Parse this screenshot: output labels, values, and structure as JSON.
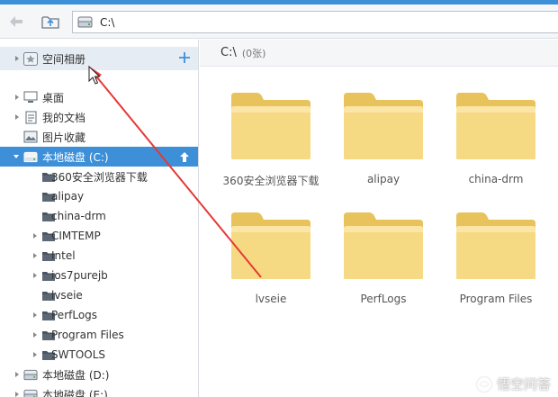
{
  "toolbar": {
    "back_icon": "back-arrow-icon",
    "up_icon": "up-folder-icon",
    "address": "C:\\",
    "address_icon": "drive-icon"
  },
  "sidebar": {
    "album": {
      "label": "空间相册",
      "icon": "album-star-icon",
      "add_icon": "plus-icon"
    },
    "items": [
      {
        "label": "桌面",
        "icon": "desktop-icon",
        "expandable": true
      },
      {
        "label": "我的文档",
        "icon": "documents-icon",
        "expandable": true
      },
      {
        "label": "图片收藏",
        "icon": "pictures-icon",
        "expandable": false
      },
      {
        "label": "本地磁盘 (C:)",
        "icon": "drive-icon",
        "expandable": true,
        "expanded": true,
        "selected": true
      },
      {
        "label": "360安全浏览器下载",
        "icon": "folder-icon",
        "expandable": false,
        "child": true
      },
      {
        "label": "alipay",
        "icon": "folder-icon",
        "expandable": false,
        "child": true
      },
      {
        "label": "china-drm",
        "icon": "folder-icon",
        "expandable": false,
        "child": true
      },
      {
        "label": "CIMTEMP",
        "icon": "folder-icon",
        "expandable": true,
        "child": true
      },
      {
        "label": "Intel",
        "icon": "folder-icon",
        "expandable": true,
        "child": true
      },
      {
        "label": "ios7purejb",
        "icon": "folder-icon",
        "expandable": true,
        "child": true
      },
      {
        "label": "lvseie",
        "icon": "folder-icon",
        "expandable": false,
        "child": true
      },
      {
        "label": "PerfLogs",
        "icon": "folder-icon",
        "expandable": true,
        "child": true
      },
      {
        "label": "Program Files",
        "icon": "folder-icon",
        "expandable": true,
        "child": true
      },
      {
        "label": "SWTOOLS",
        "icon": "folder-icon",
        "expandable": true,
        "child": true
      },
      {
        "label": "本地磁盘 (D:)",
        "icon": "drive-icon",
        "expandable": true
      },
      {
        "label": "本地磁盘 (E:)",
        "icon": "drive-icon",
        "expandable": true
      }
    ]
  },
  "main": {
    "path": "C:\\",
    "count": "(0张)",
    "folders": [
      {
        "label": "360安全浏览器下载"
      },
      {
        "label": "alipay"
      },
      {
        "label": "china-drm"
      },
      {
        "label": "lvseie"
      },
      {
        "label": "PerfLogs"
      },
      {
        "label": "Program Files"
      }
    ]
  },
  "watermark": {
    "text": "悟空问答",
    "icon": "wukong-logo-icon"
  },
  "colors": {
    "accent": "#3d8fd8",
    "folder": "#f5d57c",
    "arrow": "#e53935"
  }
}
